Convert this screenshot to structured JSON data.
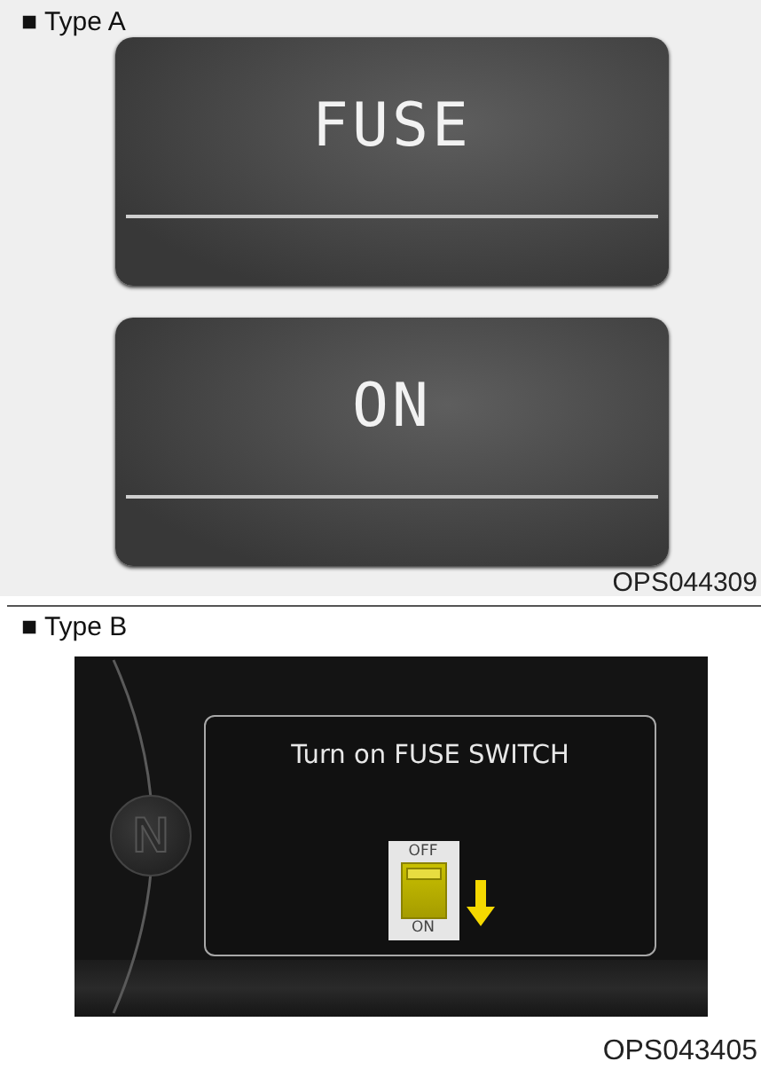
{
  "sections": [
    {
      "label": "■ Type A",
      "kind": "lcd",
      "screens": [
        {
          "text": "FUSE"
        },
        {
          "text": "ON"
        }
      ],
      "code": "OPS044309"
    },
    {
      "label": "■ Type B",
      "kind": "cluster",
      "gauge_letter": "N",
      "message": "Turn on FUSE SWITCH",
      "switch": {
        "top": "OFF",
        "bottom": "ON",
        "on": false
      },
      "code": "OPS043405"
    }
  ]
}
